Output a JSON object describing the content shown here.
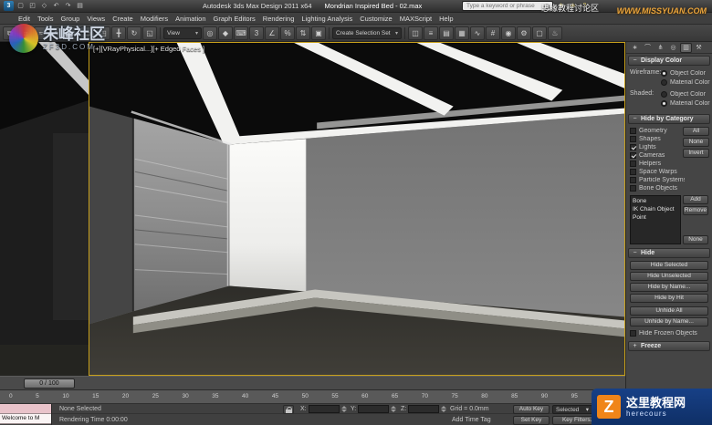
{
  "icons": {
    "chevron_down": "▾"
  },
  "colors": {
    "viewport_border": "#c9a11b",
    "watermark_orange": "#f08519",
    "watermark_blue": "#0f2f66",
    "missyuan_orange": "#e8a33d"
  },
  "title_bar": {
    "quick_access": [
      {
        "name": "app-logo",
        "glyph": "3"
      },
      {
        "name": "new-scene-icon",
        "glyph": "▢"
      },
      {
        "name": "open-file-icon",
        "glyph": "◰"
      },
      {
        "name": "save-file-icon",
        "glyph": "◇"
      },
      {
        "name": "undo-icon",
        "glyph": "↶"
      },
      {
        "name": "redo-icon",
        "glyph": "↷"
      },
      {
        "name": "project-folder-icon",
        "glyph": "▤"
      }
    ],
    "app_title": "Autodesk 3ds Max Design 2011 x64",
    "doc_title": "Mondrian Inspired Bed - 02.max",
    "search_placeholder": "Type a keyword or phrase",
    "infocenter_icons": [
      {
        "name": "favorites-star-icon",
        "glyph": "★"
      },
      {
        "name": "communication-center-icon",
        "glyph": "◈"
      },
      {
        "name": "help-icon",
        "glyph": "?"
      }
    ]
  },
  "watermarks": {
    "missyuan_line1": "思缘教程讨论区",
    "missyuan_line2": "WWW.MISSYUAN.COM",
    "zf_title": "朱峰社区",
    "zf_url": "ZF3D.COM",
    "here_title": "这里教程网",
    "here_sub": "herecours",
    "here_logo_letter": "Z"
  },
  "menu_bar": {
    "items": [
      "Edit",
      "Tools",
      "Group",
      "Views",
      "Create",
      "Modifiers",
      "Animation",
      "Graph Editors",
      "Rendering",
      "Lighting Analysis",
      "Customize",
      "MAXScript",
      "Help"
    ]
  },
  "toolbar": {
    "icons_left": [
      {
        "name": "select-and-link",
        "glyph": "⧉"
      },
      {
        "name": "unlink-selection",
        "glyph": "⧄"
      },
      {
        "name": "bind-to-space-warp",
        "glyph": "≈"
      },
      {
        "name": "select-object",
        "glyph": "↖"
      },
      {
        "name": "select-by-name",
        "glyph": "≣"
      },
      {
        "name": "rectangular-selection-region",
        "glyph": "▭"
      },
      {
        "name": "window-crossing-toggle",
        "glyph": "◳"
      },
      {
        "name": "select-and-move",
        "glyph": "╋"
      },
      {
        "name": "select-and-rotate",
        "glyph": "↻"
      },
      {
        "name": "select-and-scale",
        "glyph": "◱"
      }
    ],
    "view_dropdown_label": "View",
    "icons_mid": [
      {
        "name": "use-pivot-point-center",
        "glyph": "◎"
      },
      {
        "name": "select-and-manipulate",
        "glyph": "◆"
      },
      {
        "name": "keyboard-shortcut-override",
        "glyph": "⌨"
      },
      {
        "name": "snaps-toggle",
        "glyph": "3"
      },
      {
        "name": "angle-snap-toggle",
        "glyph": "∠"
      },
      {
        "name": "percent-snap-toggle",
        "glyph": "%"
      },
      {
        "name": "spinner-snap-toggle",
        "glyph": "⇅"
      },
      {
        "name": "edit-named-selection-sets",
        "glyph": "▣"
      }
    ],
    "selection_set_label": "Create Selection Set",
    "icons_right": [
      {
        "name": "mirror",
        "glyph": "◫"
      },
      {
        "name": "align",
        "glyph": "≡"
      },
      {
        "name": "layer-manager",
        "glyph": "▤"
      },
      {
        "name": "graphite-modeling-tools-toggle",
        "glyph": "▦"
      },
      {
        "name": "curve-editor",
        "glyph": "∿"
      },
      {
        "name": "schematic-view",
        "glyph": "#"
      },
      {
        "name": "material-editor",
        "glyph": "◉"
      },
      {
        "name": "render-setup",
        "glyph": "⚙"
      },
      {
        "name": "rendered-frame-window",
        "glyph": "▢"
      },
      {
        "name": "render-production",
        "glyph": "♨"
      }
    ]
  },
  "viewport": {
    "label": "[+][VRayPhysical...][+ Edged Faces ]"
  },
  "command_panel": {
    "tabs": [
      {
        "name": "tab-create",
        "glyph": "∗"
      },
      {
        "name": "tab-modify",
        "glyph": "⌒"
      },
      {
        "name": "tab-hierarchy",
        "glyph": "⋔"
      },
      {
        "name": "tab-motion",
        "glyph": "◎"
      },
      {
        "name": "tab-display",
        "glyph": "▥",
        "active": true
      },
      {
        "name": "tab-utilities",
        "glyph": "⚒"
      }
    ],
    "display_color": {
      "toggle": "−",
      "title": "Display Color",
      "wireframe_label": "Wireframe:",
      "wireframe_options": [
        {
          "label": "Object Color",
          "selected": true
        },
        {
          "label": "Material Color",
          "selected": false
        }
      ],
      "shaded_label": "Shaded:",
      "shaded_options": [
        {
          "label": "Object Color",
          "selected": false
        },
        {
          "label": "Material Color",
          "selected": true
        }
      ]
    },
    "hide_by_category": {
      "toggle": "−",
      "title": "Hide by Category",
      "categories": [
        {
          "label": "Geometry",
          "checked": false
        },
        {
          "label": "Shapes",
          "checked": false
        },
        {
          "label": "Lights",
          "checked": true
        },
        {
          "label": "Cameras",
          "checked": true
        },
        {
          "label": "Helpers",
          "checked": false
        },
        {
          "label": "Space Warps",
          "checked": false
        },
        {
          "label": "Particle Systems",
          "checked": false
        },
        {
          "label": "Bone Objects",
          "checked": false
        }
      ],
      "side_buttons": [
        "All",
        "None",
        "Invert"
      ],
      "list_items": [
        "Bone",
        "IK Chain Object",
        "Point"
      ],
      "list_buttons": [
        "Add",
        "Remove",
        "None"
      ]
    },
    "hide": {
      "toggle": "−",
      "title": "Hide",
      "buttons": [
        "Hide Selected",
        "Hide Unselected",
        "Hide by Name...",
        "Hide by Hit"
      ],
      "unhide_buttons": [
        "Unhide All",
        "Unhide by Name..."
      ],
      "frozen_checkbox": {
        "label": "Hide Frozen Objects",
        "checked": false
      }
    },
    "freeze": {
      "toggle": "+",
      "title": "Freeze"
    }
  },
  "timeline": {
    "slider_label": "0 / 100",
    "ticks": [
      "0",
      "5",
      "10",
      "15",
      "20",
      "25",
      "30",
      "35",
      "40",
      "45",
      "50",
      "55",
      "60",
      "65",
      "70",
      "75",
      "80",
      "85",
      "90",
      "95"
    ]
  },
  "status_bar": {
    "listener_line": "Welcome to M",
    "prompt_line": "None Selected",
    "render_time_line": "Rendering Time 0:00:00",
    "coords": {
      "x_label": "X:",
      "x_value": "",
      "y_label": "Y:",
      "y_value": "",
      "z_label": "Z:",
      "z_value": ""
    },
    "grid_label": "Grid = 0.0mm",
    "add_time_tag": "Add Time Tag",
    "auto_key": "Auto Key",
    "set_key": "Set Key",
    "selected_dropdown": "Selected",
    "key_filters": "Key Filters..."
  }
}
